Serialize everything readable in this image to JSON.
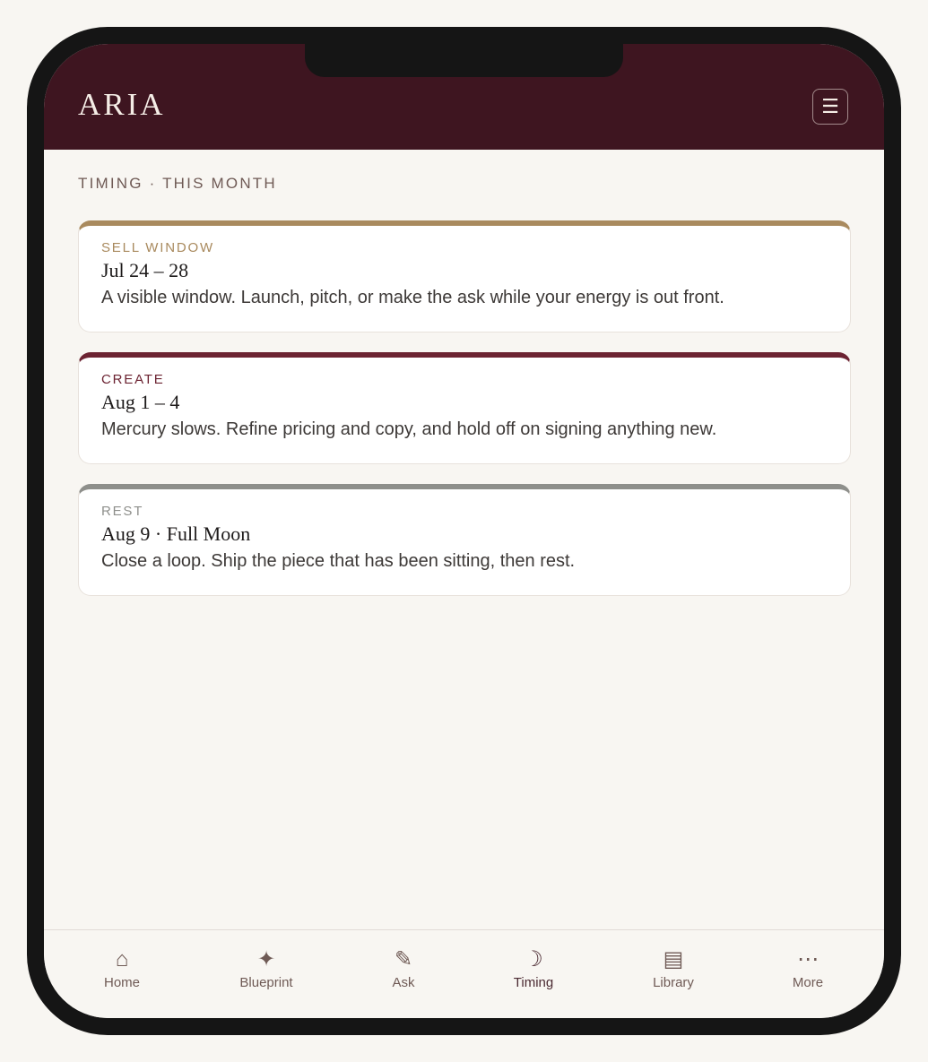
{
  "app": {
    "logo": "ARIA",
    "menu_icon": "hamburger-menu-icon",
    "colors": {
      "header": "#3e1520",
      "background": "#f8f6f2",
      "gold": "#a98a5e",
      "plum": "#6c2332",
      "grey": "#8e8f8b"
    }
  },
  "section": {
    "title": "TIMING · THIS MONTH"
  },
  "cards": [
    {
      "kicker": "SELL WINDOW",
      "date": "Jul 24 – 28",
      "text": "A visible window. Launch, pitch, or make the ask while your energy is out front.",
      "accent": "#a98a5e"
    },
    {
      "kicker": "CREATE",
      "date": "Aug 1 – 4",
      "text": "Mercury slows. Refine pricing and copy, and hold off on signing anything new.",
      "accent": "#6c2332"
    },
    {
      "kicker": "REST",
      "date": "Aug 9 · Full Moon",
      "text": "Close a loop. Ship the piece that has been sitting, then rest.",
      "accent": "#8e8f8b"
    }
  ],
  "tabbar": {
    "items": [
      {
        "label": "Home",
        "icon": "home-icon",
        "glyph": "⌂"
      },
      {
        "label": "Blueprint",
        "icon": "sparkle-icon",
        "glyph": "✦"
      },
      {
        "label": "Ask",
        "icon": "pencil-icon",
        "glyph": "✎"
      },
      {
        "label": "Timing",
        "icon": "moon-icon",
        "glyph": "☽",
        "active": true
      },
      {
        "label": "Library",
        "icon": "library-icon",
        "glyph": "▤"
      },
      {
        "label": "More",
        "icon": "more-icon",
        "glyph": "⋯"
      }
    ]
  }
}
